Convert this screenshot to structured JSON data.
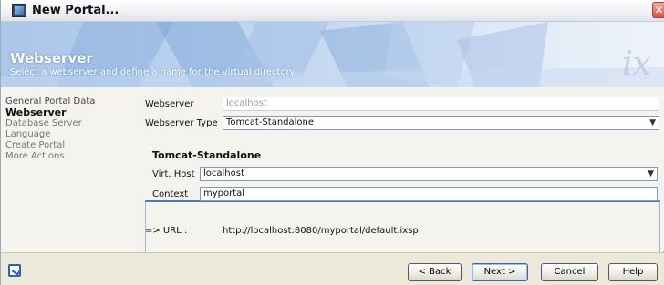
{
  "window": {
    "title": "New Portal...",
    "close_glyph": "✕"
  },
  "banner": {
    "title": "Webserver",
    "subtitle": "Select a webserver and define a name for the virtual directory.",
    "logo_text": "ix"
  },
  "steps": [
    {
      "label": "General Portal Data",
      "state": "done"
    },
    {
      "label": "Webserver",
      "state": "active"
    },
    {
      "label": "Database Server",
      "state": "pending"
    },
    {
      "label": "Language",
      "state": "pending"
    },
    {
      "label": "Create Portal",
      "state": "pending"
    },
    {
      "label": "More Actions",
      "state": "pending"
    }
  ],
  "form": {
    "webserver_label": "Webserver",
    "webserver_value": "localhost",
    "webserver_type_label": "Webserver Type",
    "webserver_type_value": "Tomcat-Standalone",
    "group_title": "Tomcat-Standalone",
    "virt_host_label": "Virt. Host",
    "virt_host_value": "localhost",
    "context_label": "Context",
    "context_value": "myportal",
    "url_label": "=> URL :",
    "url_value": "http://localhost:8080/myportal/default.ixsp"
  },
  "footer": {
    "back_label": "< Back",
    "next_label": "Next >",
    "cancel_label": "Cancel",
    "help_label": "Help"
  },
  "icons": {
    "app": "app-icon",
    "close": "close-icon",
    "help": "help-checkbox-icon",
    "dropdown": "chevron-down-icon"
  },
  "colors": {
    "banner_start": "#a9c6e9",
    "group_accent": "#4a7ab5",
    "field_border": "#7f9db9"
  }
}
